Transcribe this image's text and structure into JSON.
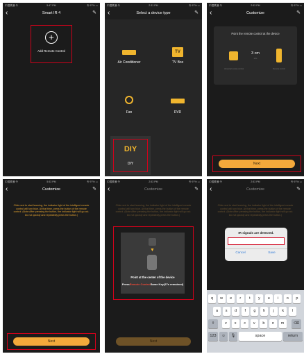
{
  "status": {
    "carrier": "中国联通 令",
    "battery": "令 97% ▭",
    "times": [
      "5:47 PM",
      "2:31 PM",
      "2:53 PM",
      "5:53 PM",
      "2:53 PM",
      "2:53 PM"
    ]
  },
  "screen1": {
    "title": "Smart IR 4",
    "add_label": "Add Remote Control"
  },
  "screen2": {
    "title": "Select a device type",
    "devices": [
      {
        "label": "Air Conditioner"
      },
      {
        "label": "TV Box",
        "glyph": "TV"
      },
      {
        "label": "Fan"
      },
      {
        "label": "DVD"
      },
      {
        "label": "DIY",
        "glyph": "DIY"
      }
    ]
  },
  "screen3": {
    "title": "Customize",
    "prompt": "Point the remote control at the device",
    "distance": "3 cm",
    "distance_sub": "info",
    "left_caption": "Universal remote control",
    "right_caption": "Remote control",
    "next_label": "Next"
  },
  "instructions": "Click next to start learning, the indicator light of the intelligent remote control will turn blue. At that time, press the button of the remote control. (Note:After pressing the button, the indicator light will go out. Do not quickly and repeatedly press the button.)",
  "screen4": {
    "title": "Customize",
    "next_label": "Next"
  },
  "screen5": {
    "title": "Customize",
    "point_text": "Point at the center of the device",
    "press_prefix": "Press",
    "press_highlight": "Remote Control",
    "press_suffix": "Same Key(27s remained)",
    "next_label": "Next"
  },
  "screen6": {
    "title": "Customize",
    "dialog_title": "IR signals are detected.",
    "cancel_label": "Cancel",
    "save_label": "Save",
    "keyboard": {
      "row1": [
        "q",
        "w",
        "e",
        "r",
        "t",
        "y",
        "u",
        "i",
        "o",
        "p"
      ],
      "row2": [
        "a",
        "s",
        "d",
        "f",
        "g",
        "h",
        "j",
        "k",
        "l"
      ],
      "row3": [
        "z",
        "x",
        "c",
        "v",
        "b",
        "n",
        "m"
      ],
      "shift": "⇧",
      "delete": "⌫",
      "num": "123",
      "emoji": "☺",
      "mic": "🎙",
      "space": "space",
      "return": "return"
    }
  },
  "colors": {
    "accent": "#f3a93b",
    "highlight": "#d0021b",
    "background": "#1b1b1b"
  }
}
